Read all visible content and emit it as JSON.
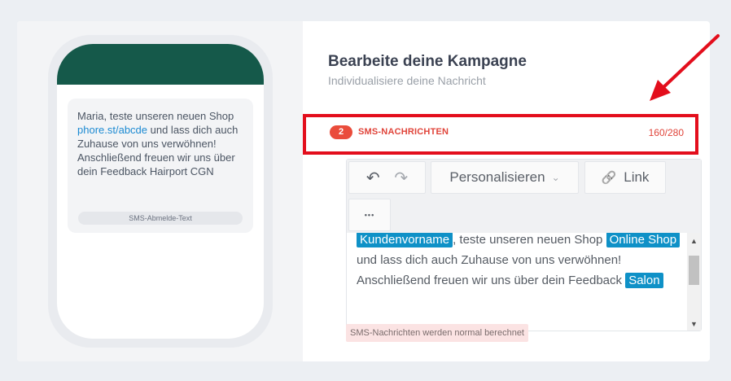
{
  "preview": {
    "message_before_link": "Maria, teste unseren neuen Shop ",
    "link": "phore.st/abcde",
    "message_after_link": " und lass dich auch Zuhause von uns verwöhnen! Anschließend freuen wir uns über dein Feedback Hairport CGN",
    "optout_label": "SMS-Abmelde-Text"
  },
  "header": {
    "title": "Bearbeite deine Kampagne",
    "subtitle": "Individualisiere deine Nachricht"
  },
  "sms": {
    "count": "2",
    "label": "SMS-NACHRICHTEN",
    "char_count": "160/280"
  },
  "toolbar": {
    "undo_icon": "↶",
    "redo_icon": "↷",
    "personalize_label": "Personalisieren",
    "chevron_icon": "⌄",
    "link_icon": "🔗",
    "link_label": "Link",
    "more_icon": "•••"
  },
  "editor": {
    "tag_customer": "Kundenvorname",
    "text_1": ", teste unseren neuen Shop ",
    "tag_shop": "Online Shop",
    "text_2": " und lass dich auch Zuhause von uns verwöhnen! Anschließend freuen wir uns über dein Feedback ",
    "tag_salon": "Salon"
  },
  "scrollbar": {
    "up_icon": "▲",
    "down_icon": "▼"
  },
  "notice": "SMS-Nachrichten werden normal berechnet",
  "colors": {
    "brand_green": "#15594a",
    "accent_red": "#e0443a",
    "tag_blue": "#0f91c7",
    "annotation_red": "#e30e1c"
  }
}
